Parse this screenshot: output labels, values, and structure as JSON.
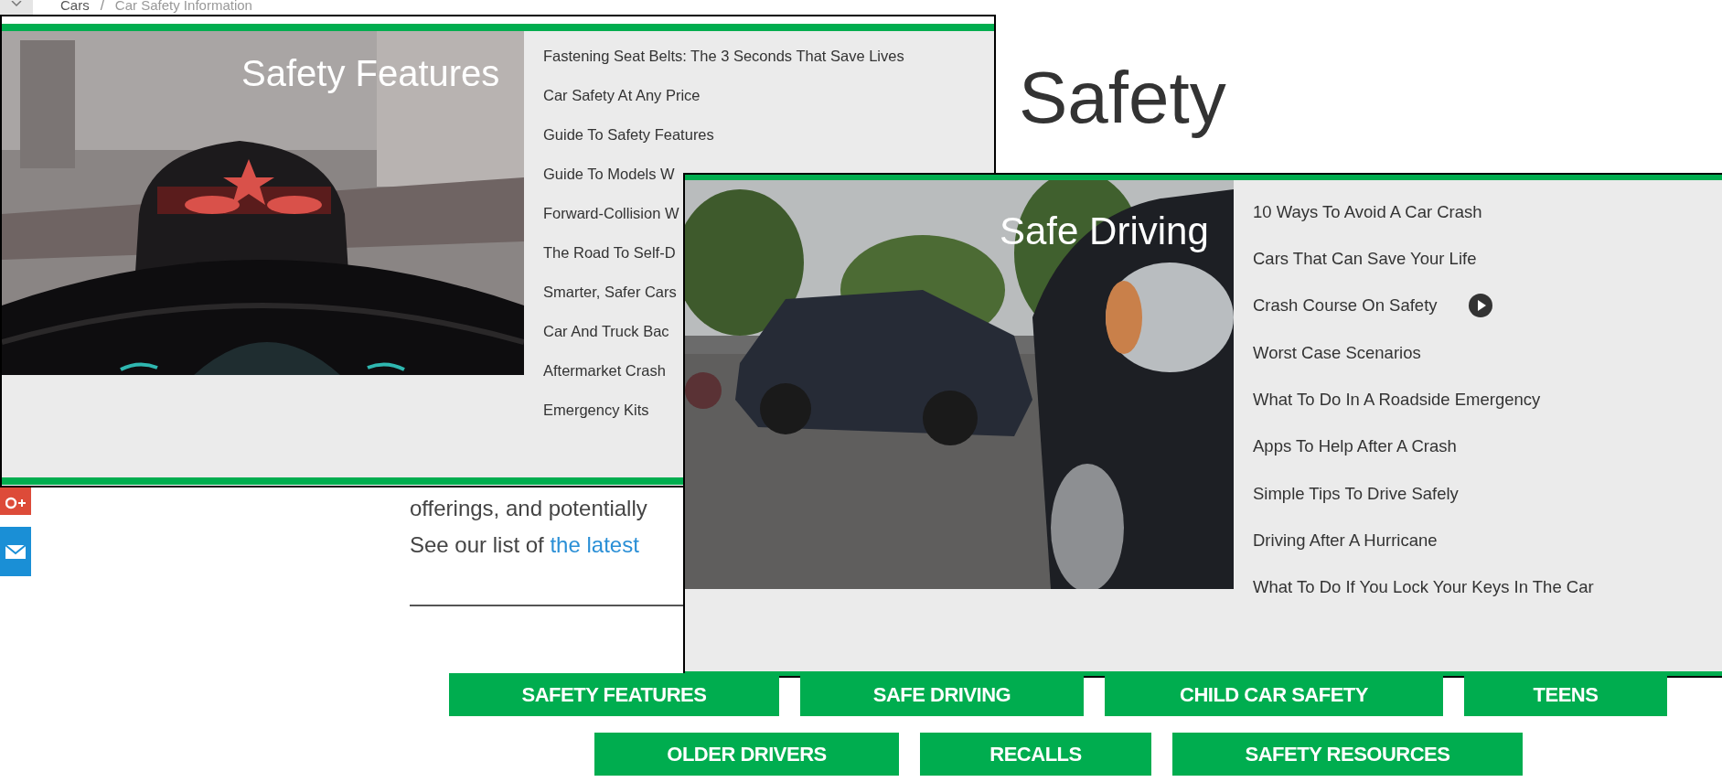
{
  "breadcrumb": {
    "items": [
      "Cars",
      "Car Safety Information"
    ],
    "separator": "/"
  },
  "page": {
    "heading": "Safety",
    "lines": [
      "offerings, and potentially"
    ],
    "link_sentence": {
      "lead": "See our list of ",
      "link": "the latest"
    }
  },
  "panels": [
    {
      "title": "Safety Features",
      "items": [
        {
          "label": "Fastening Seat Belts: The 3 Seconds That Save Lives",
          "video": false
        },
        {
          "label": "Car Safety At Any Price",
          "video": false
        },
        {
          "label": "Guide To Safety Features",
          "video": false
        },
        {
          "label": "Guide To Models W",
          "video": false
        },
        {
          "label": "Forward-Collision W",
          "video": false
        },
        {
          "label": "The Road To Self-D",
          "video": false
        },
        {
          "label": "Smarter, Safer Cars",
          "video": false
        },
        {
          "label": "Car And Truck Bac",
          "video": false
        },
        {
          "label": "Aftermarket Crash",
          "video": false
        },
        {
          "label": "Emergency Kits",
          "video": false
        }
      ]
    },
    {
      "title": "Safe Driving",
      "items": [
        {
          "label": "10 Ways To Avoid A Car Crash",
          "video": false
        },
        {
          "label": "Cars That Can Save Your Life",
          "video": false
        },
        {
          "label": "Crash Course On Safety",
          "video": true
        },
        {
          "label": "Worst Case Scenarios",
          "video": false
        },
        {
          "label": "What To Do In A Roadside Emergency",
          "video": false
        },
        {
          "label": "Apps To Help After A Crash",
          "video": false
        },
        {
          "label": "Simple Tips To Drive Safely",
          "video": false
        },
        {
          "label": "Driving After A Hurricane",
          "video": false
        },
        {
          "label": "What To Do If You Lock Your Keys In The Car",
          "video": false
        }
      ]
    }
  ],
  "category_buttons": [
    [
      "SAFETY FEATURES",
      "SAFE DRIVING",
      "CHILD CAR SAFETY",
      "TEENS"
    ],
    [
      "OLDER DRIVERS",
      "RECALLS",
      "SAFETY RESOURCES"
    ]
  ]
}
